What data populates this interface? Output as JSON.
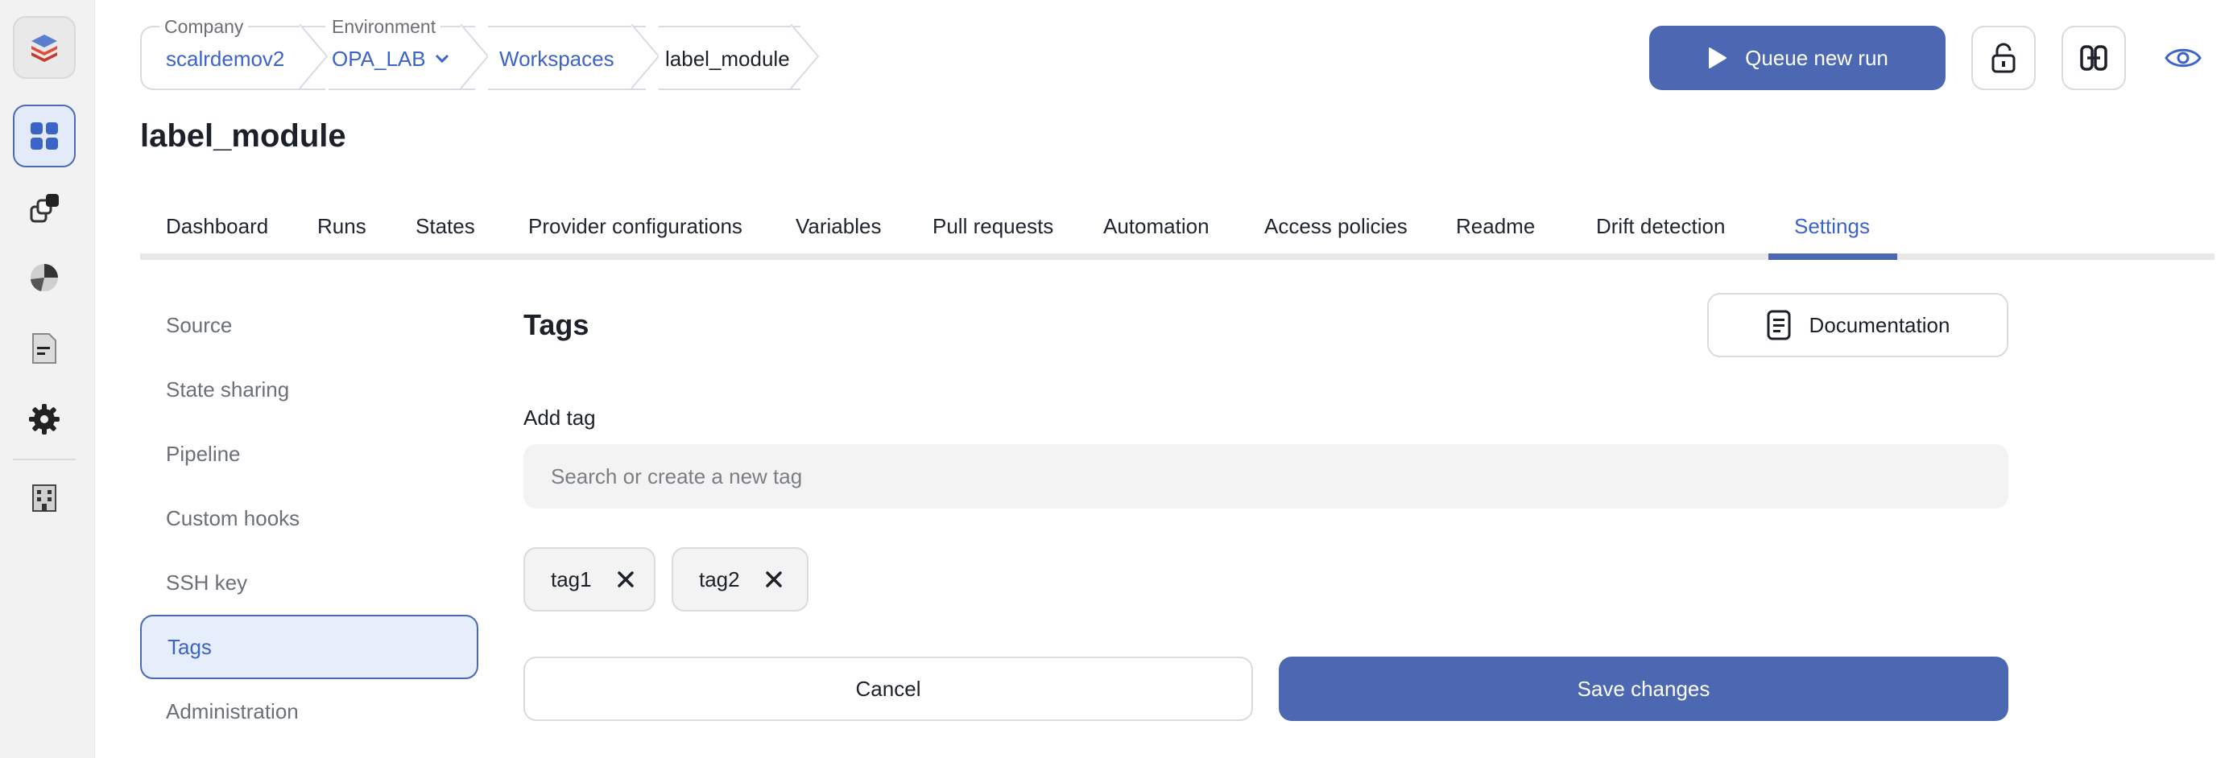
{
  "rail": {
    "items": [
      {
        "icon": "logo-stack-icon"
      },
      {
        "icon": "dashboard-grid-icon"
      },
      {
        "icon": "modules-icon"
      },
      {
        "icon": "pie-chart-icon"
      },
      {
        "icon": "document-icon"
      },
      {
        "icon": "gear-icon"
      },
      {
        "icon": "building-icon"
      }
    ]
  },
  "breadcrumb": {
    "company_label": "Company",
    "company_value": "scalrdemov2",
    "environment_label": "Environment",
    "environment_value": "OPA_LAB",
    "workspaces": "Workspaces",
    "current": "label_module"
  },
  "header": {
    "queue_run_label": "Queue new run",
    "lock_icon": "unlock-icon",
    "link_icon": "link-icon",
    "eye_icon": "eye-icon"
  },
  "page_title": "label_module",
  "tabs": [
    "Dashboard",
    "Runs",
    "States",
    "Provider configurations",
    "Variables",
    "Pull requests",
    "Automation",
    "Access policies",
    "Readme",
    "Drift detection",
    "Settings"
  ],
  "active_tab": "Settings",
  "settings_nav": [
    "Source",
    "State sharing",
    "Pipeline",
    "Custom hooks",
    "SSH key",
    "Tags",
    "Administration"
  ],
  "active_settings_item": "Tags",
  "content": {
    "title": "Tags",
    "documentation_label": "Documentation",
    "add_tag_label": "Add tag",
    "tag_input_placeholder": "Search or create a new tag",
    "tag_input_value": "",
    "tags": [
      "tag1",
      "tag2"
    ],
    "cancel_label": "Cancel",
    "save_label": "Save changes"
  },
  "colors": {
    "accent": "#4c68b3",
    "link": "#3c63c6",
    "border": "#d8dbe1",
    "input_bg": "#f3f3f3"
  }
}
